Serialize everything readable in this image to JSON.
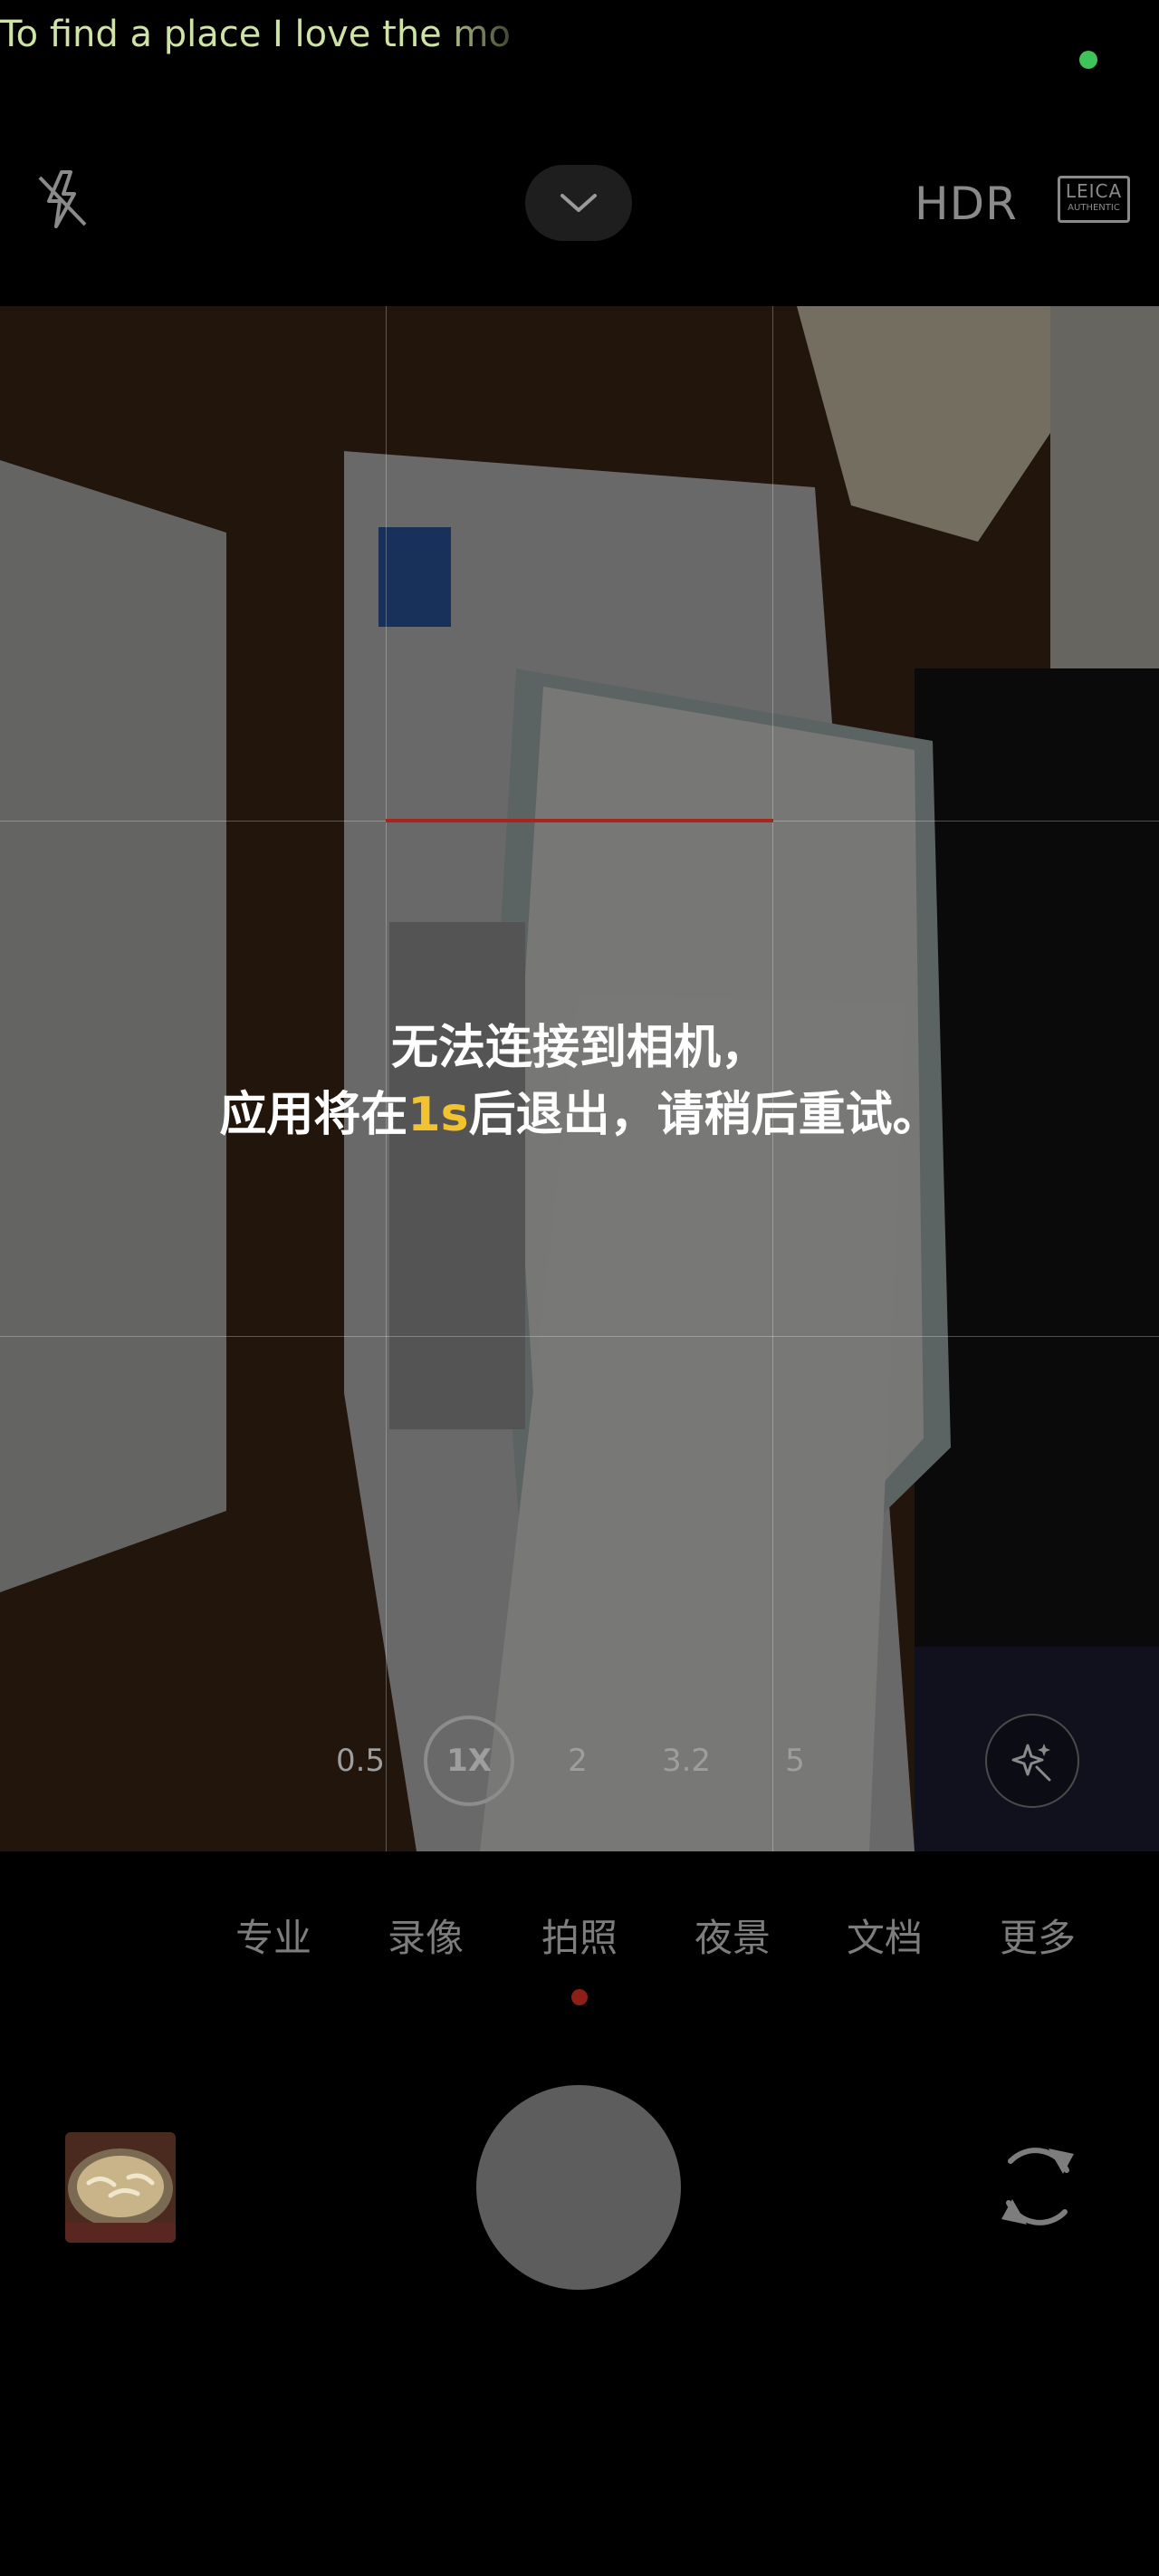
{
  "status": {
    "lyric_text": "To find a place I love the mo"
  },
  "topbar": {
    "hdr_label": "HDR",
    "leica_line1": "LEICA",
    "leica_line2": "AUTHENTIC"
  },
  "viewfinder": {
    "error_line1": "无法连接到相机，",
    "error_line2_prefix": "应用将在",
    "error_countdown": "1s",
    "error_line2_suffix": "后退出，请稍后重试。"
  },
  "zoom": {
    "options": [
      "0.5",
      "1X",
      "2",
      "3.2",
      "5"
    ],
    "selected": "1X"
  },
  "modes": {
    "items": [
      "专业",
      "录像",
      "拍照",
      "夜景",
      "文档",
      "更多"
    ],
    "selected": "拍照"
  },
  "colors": {
    "countdown_accent": "#f2c230",
    "level_line": "#a8251d",
    "recording_dot": "#3ec45a",
    "active_mode_dot": "#8e1e18"
  },
  "icons": {
    "flash": "flash-off-icon",
    "collapse": "chevron-down-icon",
    "magic": "ai-enhance-icon",
    "switch_camera": "switch-camera-icon"
  }
}
